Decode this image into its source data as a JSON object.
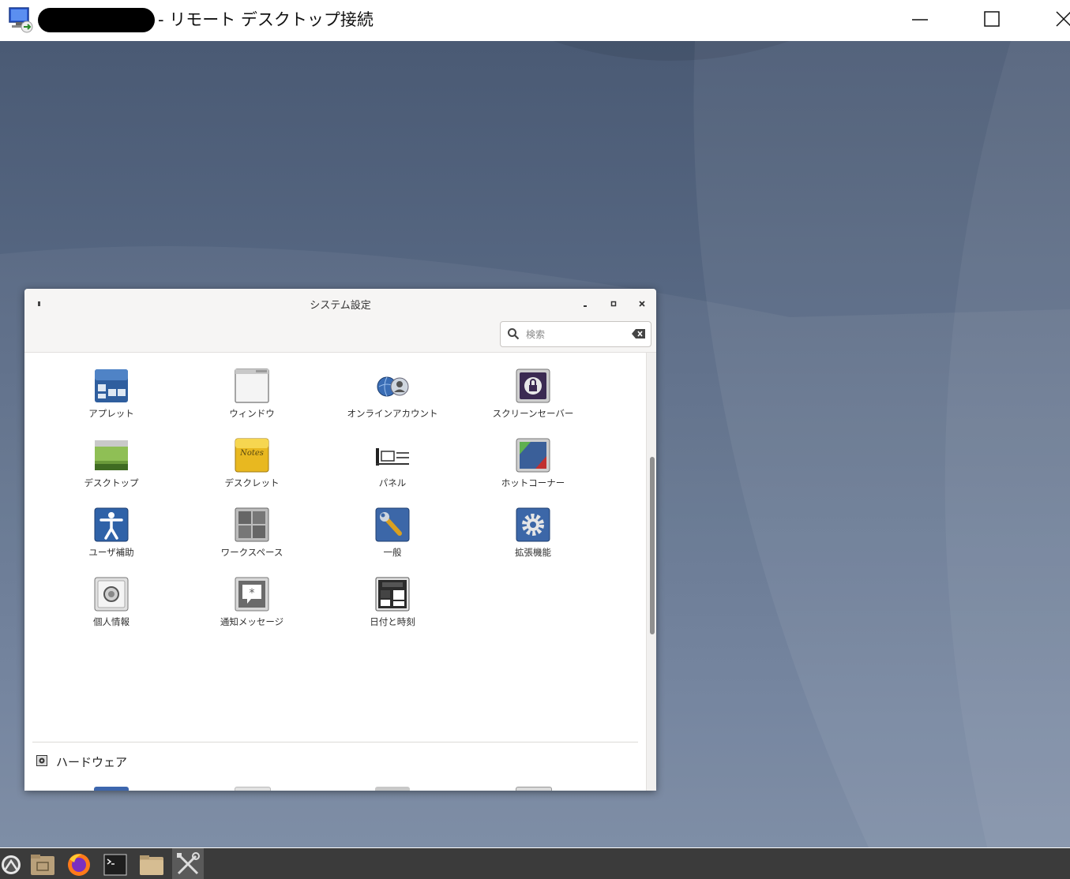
{
  "rdp": {
    "title": "- リモート デスクトップ接続",
    "icon": "remote-desktop-icon",
    "controls": [
      "minimize-icon",
      "maximize-icon",
      "close-icon"
    ]
  },
  "window": {
    "title": "システム設定",
    "controls": [
      "minimize-icon",
      "maximize-icon",
      "close-icon"
    ],
    "search": {
      "placeholder": "検索",
      "value": ""
    },
    "items": [
      {
        "label": "アプレット",
        "icon": "applets-icon"
      },
      {
        "label": "ウィンドウ",
        "icon": "windows-icon"
      },
      {
        "label": "オンラインアカウント",
        "icon": "online-accounts-icon"
      },
      {
        "label": "スクリーンセーバー",
        "icon": "screensaver-icon"
      },
      {
        "label": "デスクトップ",
        "icon": "desktop-icon"
      },
      {
        "label": "デスクレット",
        "icon": "desklets-icon"
      },
      {
        "label": "パネル",
        "icon": "panel-icon"
      },
      {
        "label": "ホットコーナー",
        "icon": "hot-corners-icon"
      },
      {
        "label": "ユーザ補助",
        "icon": "accessibility-icon"
      },
      {
        "label": "ワークスペース",
        "icon": "workspaces-icon"
      },
      {
        "label": "一般",
        "icon": "general-icon"
      },
      {
        "label": "拡張機能",
        "icon": "extensions-icon"
      },
      {
        "label": "個人情報",
        "icon": "privacy-icon"
      },
      {
        "label": "通知メッセージ",
        "icon": "notifications-icon"
      },
      {
        "label": "日付と時刻",
        "icon": "date-time-icon"
      }
    ],
    "section": {
      "label": "ハードウェア",
      "icon": "hardware-icon"
    }
  },
  "taskbar": {
    "items": [
      "menu-icon",
      "files-icon",
      "firefox-icon",
      "terminal-icon",
      "folder-icon",
      "settings-icon"
    ],
    "active": "settings-icon"
  }
}
